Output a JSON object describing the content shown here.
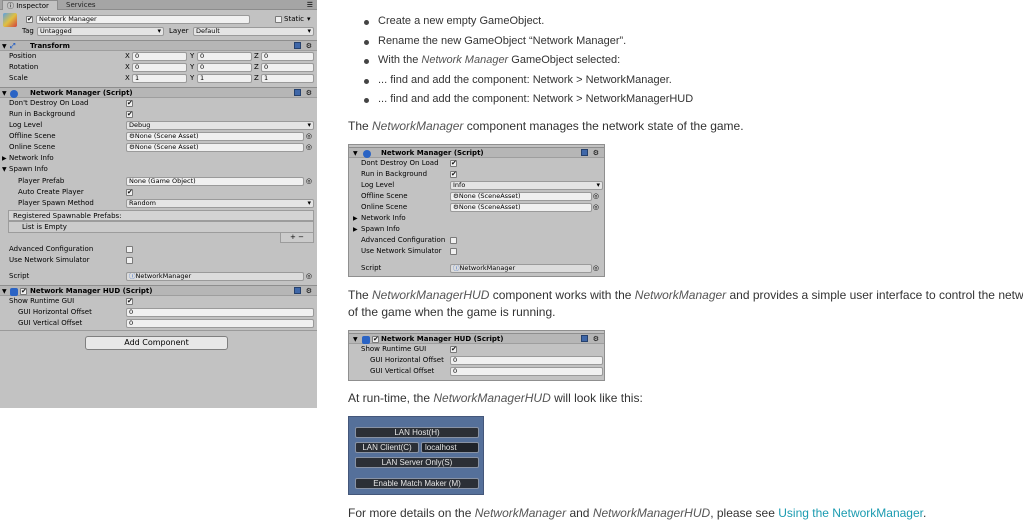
{
  "inspector": {
    "tabs": [
      "Inspector",
      "Services"
    ],
    "object_name": "Network Manager",
    "static_label": "Static",
    "tag_label": "Tag",
    "tag_value": "Untagged",
    "layer_label": "Layer",
    "layer_value": "Default",
    "transform": {
      "title": "Transform",
      "rows": [
        {
          "label": "Position",
          "x": "0",
          "y": "0",
          "z": "0"
        },
        {
          "label": "Rotation",
          "x": "0",
          "y": "0",
          "z": "0"
        },
        {
          "label": "Scale",
          "x": "1",
          "y": "1",
          "z": "1"
        }
      ],
      "axis": [
        "X",
        "Y",
        "Z"
      ]
    },
    "network_manager": {
      "title": "Network Manager (Script)",
      "dont_destroy": "Don't Destroy On Load",
      "run_in_background": "Run in Background",
      "log_level_label": "Log Level",
      "log_level_value": "Debug",
      "offline_scene_label": "Offline Scene",
      "offline_scene_value": "None (Scene Asset)",
      "online_scene_label": "Online Scene",
      "online_scene_value": "None (Scene Asset)",
      "network_info": "Network Info",
      "spawn_info": "Spawn Info",
      "player_prefab_label": "Player Prefab",
      "player_prefab_value": "None (Game Object)",
      "auto_create_label": "Auto Create Player",
      "spawn_method_label": "Player Spawn Method",
      "spawn_method_value": "Random",
      "registered_prefabs": "Registered Spawnable Prefabs:",
      "list_empty": "List is Empty",
      "plus_minus": "+  −",
      "advanced_config": "Advanced Configuration",
      "use_simulator": "Use Network Simulator",
      "script_label": "Script",
      "script_value": "NetworkManager"
    },
    "hud": {
      "title": "Network Manager HUD (Script)",
      "show_gui": "Show Runtime GUI",
      "h_offset_label": "GUI Horizontal Offset",
      "h_offset_value": "0",
      "v_offset_label": "GUI Vertical Offset",
      "v_offset_value": "0"
    },
    "add_component": "Add Component",
    "check": "✔"
  },
  "doc": {
    "steps": [
      "Create a new empty GameObject.",
      "Rename the new GameObject “Network Manager”.",
      "With the ",
      "... find and add the component: Network > NetworkManager.",
      "... find and add the component: Network > NetworkManagerHUD"
    ],
    "step3_em": "Network Manager",
    "step3_tail": " GameObject selected:",
    "p1_a": "The ",
    "p1_em": "NetworkManager",
    "p1_b": " component manages the network state of the game.",
    "p2_a": "The ",
    "p2_em1": "NetworkManagerHUD",
    "p2_b": " component works with the ",
    "p2_em2": "NetworkManager",
    "p2_c": " and provides a simple user interface to control the network state",
    "p2_line2": "of the game when the game is running.",
    "p3_a": "At run-time, the ",
    "p3_em": "NetworkManagerHUD",
    "p3_b": " will look like this:",
    "p4_a": "For more details on the ",
    "p4_em1": "NetworkManager",
    "p4_b": " and ",
    "p4_em2": "NetworkManagerHUD",
    "p4_c": ", please see ",
    "p4_link": "Using the NetworkManager",
    "p4_d": "."
  },
  "doc_nm": {
    "title": "Network Manager (Script)",
    "dont_destroy": "Dont Destroy On Load",
    "run_in_background": "Run in Background",
    "log_level_label": "Log Level",
    "log_level_value": "Info",
    "offline_label": "Offline Scene",
    "offline_value": "None (SceneAsset)",
    "online_label": "Online Scene",
    "online_value": "None (SceneAsset)",
    "network_info": "Network Info",
    "spawn_info": "Spawn Info",
    "advanced": "Advanced Configuration",
    "simulator": "Use Network Simulator",
    "script_label": "Script",
    "script_value": "NetworkManager"
  },
  "doc_hud": {
    "title": "Network Manager HUD (Script)",
    "show_gui": "Show Runtime GUI",
    "h_label": "GUI Horizontal Offset",
    "h_value": "0",
    "v_label": "GUI Vertical Offset",
    "v_value": "0"
  },
  "runtime_hud": {
    "lan_host": "LAN Host(H)",
    "lan_client": "LAN Client(C)",
    "client_address": "localhost",
    "lan_server": "LAN Server Only(S)",
    "match_maker": "Enable Match Maker (M)"
  }
}
